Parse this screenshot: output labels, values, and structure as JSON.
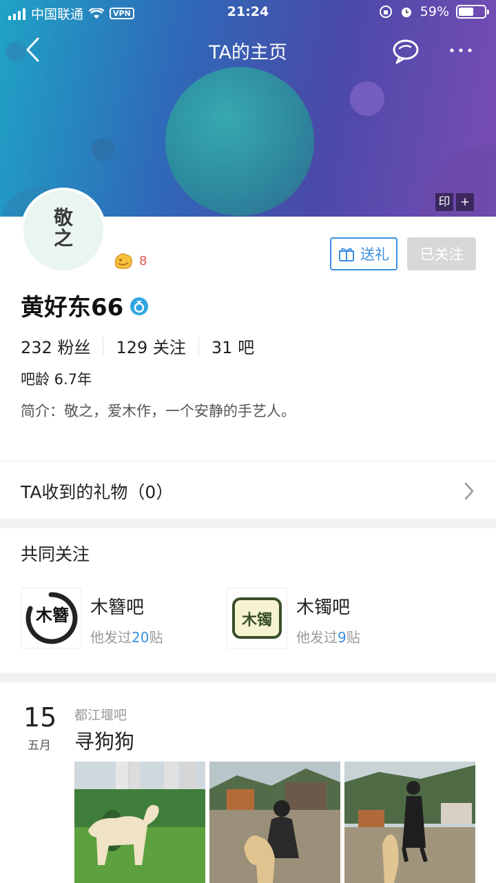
{
  "status": {
    "carrier": "中国联通",
    "vpn": "VPN",
    "time": "21:24",
    "battery": "59%"
  },
  "nav": {
    "title": "TA的主页"
  },
  "banner": {
    "stamp_tool": "印",
    "add_tool": "+"
  },
  "profile": {
    "level": "8",
    "name": "黄好东66",
    "gift_button": "送礼",
    "follow_button": "已关注",
    "stats": [
      {
        "value": "232",
        "label": "粉丝"
      },
      {
        "value": "129",
        "label": "关注"
      },
      {
        "value": "31",
        "label": "吧"
      }
    ],
    "age": "吧龄 6.7年",
    "bio": "简介：敬之，爱木作，一个安静的手艺人。",
    "avatar_text": [
      "敬",
      "之"
    ]
  },
  "gifts": {
    "label": "TA收到的礼物（0）"
  },
  "common": {
    "title": "共同关注",
    "forums": [
      {
        "name": "木簪吧",
        "prefix": "他发过",
        "count": "20",
        "suffix": "贴",
        "logo_text": "木簪"
      },
      {
        "name": "木镯吧",
        "prefix": "他发过",
        "count": "9",
        "suffix": "贴",
        "logo_text": "木镯"
      }
    ]
  },
  "post": {
    "day": "15",
    "month": "五月",
    "forum": "都江堰吧",
    "title": "寻狗狗"
  },
  "colors": {
    "accent": "#3a8ee0",
    "level": "#e2534a"
  }
}
